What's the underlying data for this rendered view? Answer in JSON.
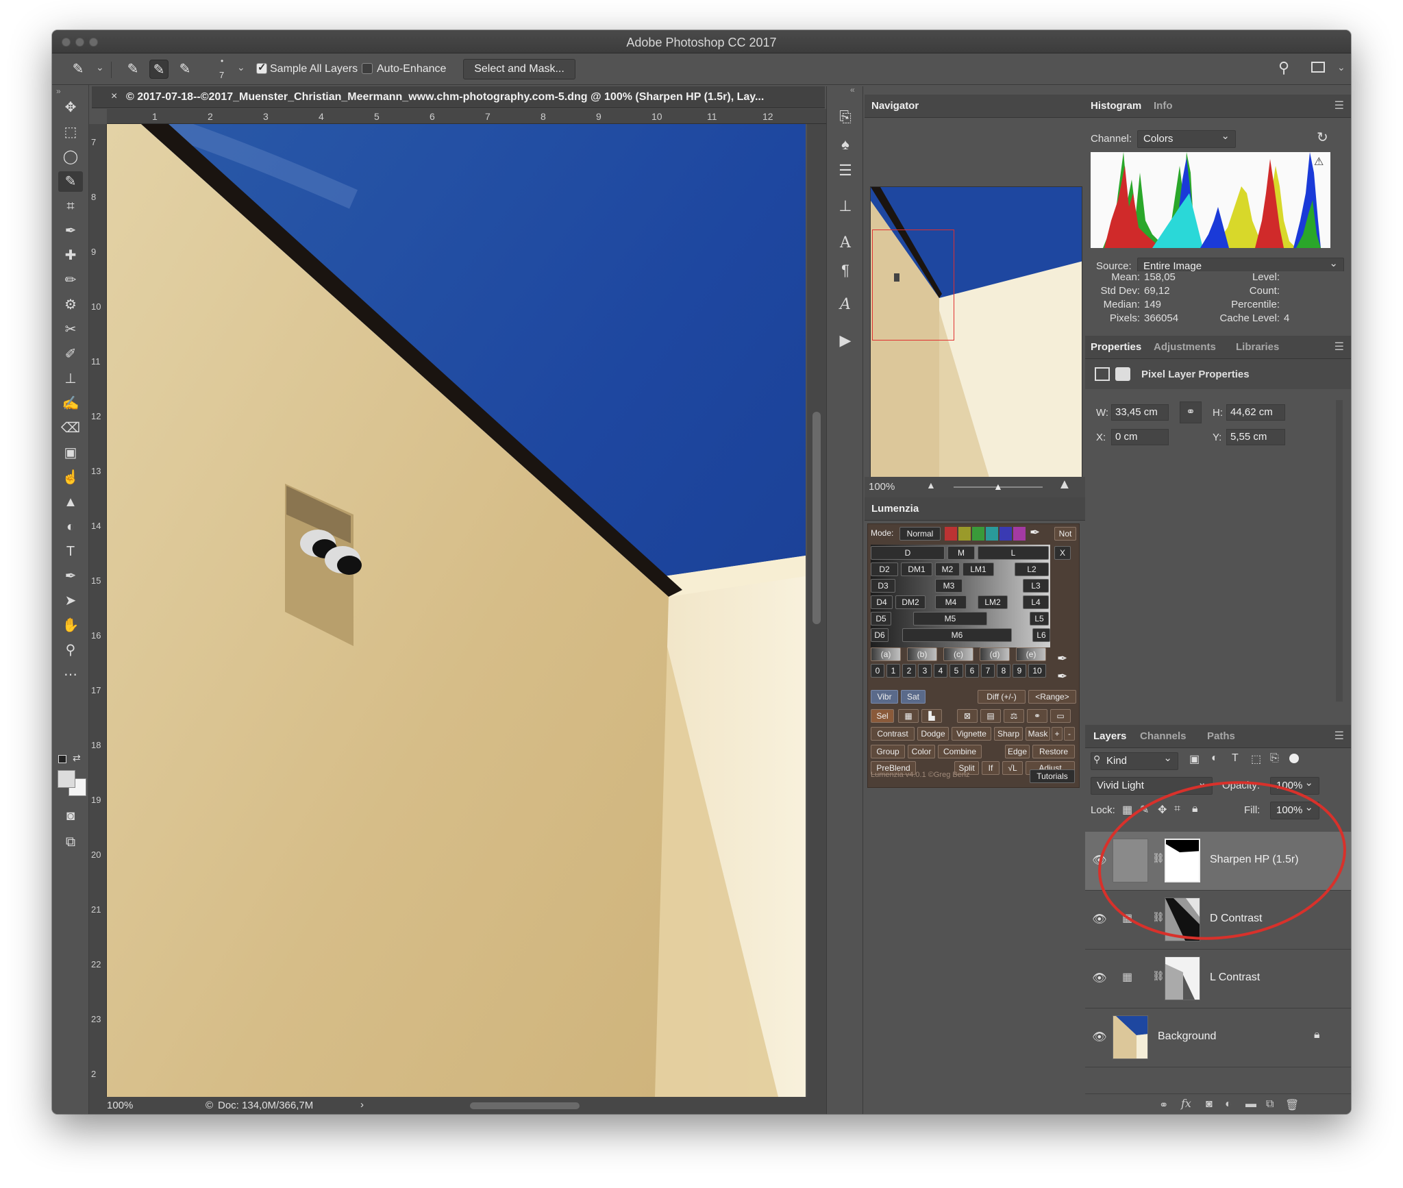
{
  "window": {
    "title": "Adobe Photoshop CC 2017"
  },
  "options_bar": {
    "brush_size": "7",
    "sample_all_layers_label": "Sample All Layers",
    "sample_all_layers_checked": true,
    "auto_enhance_label": "Auto-Enhance",
    "auto_enhance_checked": false,
    "select_and_mask_label": "Select and Mask..."
  },
  "document": {
    "tab_title": "© 2017-07-18--©2017_Muenster_Christian_Meermann_www.chm-photography.com-5.dng @ 100% (Sharpen HP (1.5r), Lay...",
    "zoom": "100%",
    "doc_size": "Doc: 134,0M/366,7M",
    "ruler_h": [
      "1",
      "2",
      "3",
      "4",
      "5",
      "6",
      "7",
      "8",
      "9",
      "10",
      "11",
      "12"
    ],
    "ruler_v": [
      "7",
      "8",
      "9",
      "10",
      "11",
      "12",
      "13",
      "14",
      "15",
      "16",
      "17",
      "18",
      "19",
      "20",
      "21",
      "22",
      "23",
      "2"
    ]
  },
  "navigator": {
    "title": "Navigator",
    "zoom": "100%"
  },
  "histogram": {
    "tabs": [
      "Histogram",
      "Info"
    ],
    "channel_label": "Channel:",
    "channel_value": "Colors",
    "source_label": "Source:",
    "source_value": "Entire Image",
    "stats_left": [
      {
        "label": "Mean:",
        "value": "158,05"
      },
      {
        "label": "Std Dev:",
        "value": "69,12"
      },
      {
        "label": "Median:",
        "value": "149"
      },
      {
        "label": "Pixels:",
        "value": "366054"
      }
    ],
    "stats_right": [
      {
        "label": "Level:",
        "value": ""
      },
      {
        "label": "Count:",
        "value": ""
      },
      {
        "label": "Percentile:",
        "value": ""
      },
      {
        "label": "Cache Level:",
        "value": "4"
      }
    ]
  },
  "properties": {
    "tabs": [
      "Properties",
      "Adjustments",
      "Libraries"
    ],
    "heading": "Pixel Layer Properties",
    "w_label": "W:",
    "w_value": "33,45 cm",
    "h_label": "H:",
    "h_value": "44,62 cm",
    "x_label": "X:",
    "x_value": "0 cm",
    "y_label": "Y:",
    "y_value": "5,55 cm"
  },
  "lumenzia": {
    "title": "Lumenzia",
    "mode_label": "Mode:",
    "mode_value": "Normal",
    "not_label": "Not",
    "x_label": "X",
    "row1": [
      "D",
      "M",
      "L"
    ],
    "row2": [
      "D2",
      "DM1",
      "M2",
      "LM1",
      "L2"
    ],
    "row3": [
      "D3",
      "M3",
      "L3"
    ],
    "row4": [
      "D4",
      "DM2",
      "M4",
      "LM2",
      "L4"
    ],
    "row5": [
      "D5",
      "M5",
      "L5"
    ],
    "row6": [
      "D6",
      "M6",
      "L6"
    ],
    "letters": [
      "(a)",
      "(b)",
      "(c)",
      "(d)",
      "(e)"
    ],
    "numbers": [
      "0",
      "1",
      "2",
      "3",
      "4",
      "5",
      "6",
      "7",
      "8",
      "9",
      "10"
    ],
    "vibr": "Vibr",
    "sat": "Sat",
    "diff": "Diff (+/-)",
    "range": "<Range>",
    "sel": "Sel",
    "row_a": [
      "Contrast",
      "Dodge",
      "Vignette",
      "Sharp",
      "Mask",
      "+",
      "-"
    ],
    "row_b": [
      "Group",
      "Color",
      "Combine",
      "Edge",
      "Restore"
    ],
    "row_c": [
      "PreBlend",
      "Split",
      "If",
      "√L",
      "Adjust"
    ],
    "footer": "Lumenzia v4.0.1 ©Greg Benz",
    "tutorials": "Tutorials"
  },
  "layers": {
    "tabs": [
      "Layers",
      "Channels",
      "Paths"
    ],
    "kind_label": "Kind",
    "blend_mode": "Vivid Light",
    "opacity_label": "Opacity:",
    "opacity_value": "100%",
    "lock_label": "Lock:",
    "fill_label": "Fill:",
    "fill_value": "100%",
    "items": [
      {
        "name": "Sharpen HP (1.5r)"
      },
      {
        "name": "D Contrast"
      },
      {
        "name": "L Contrast"
      },
      {
        "name": "Background"
      }
    ]
  },
  "colors": {
    "annotation_circle": "#d8312b",
    "sky_blue": "#1e47a0",
    "wall": "#d9c394"
  }
}
